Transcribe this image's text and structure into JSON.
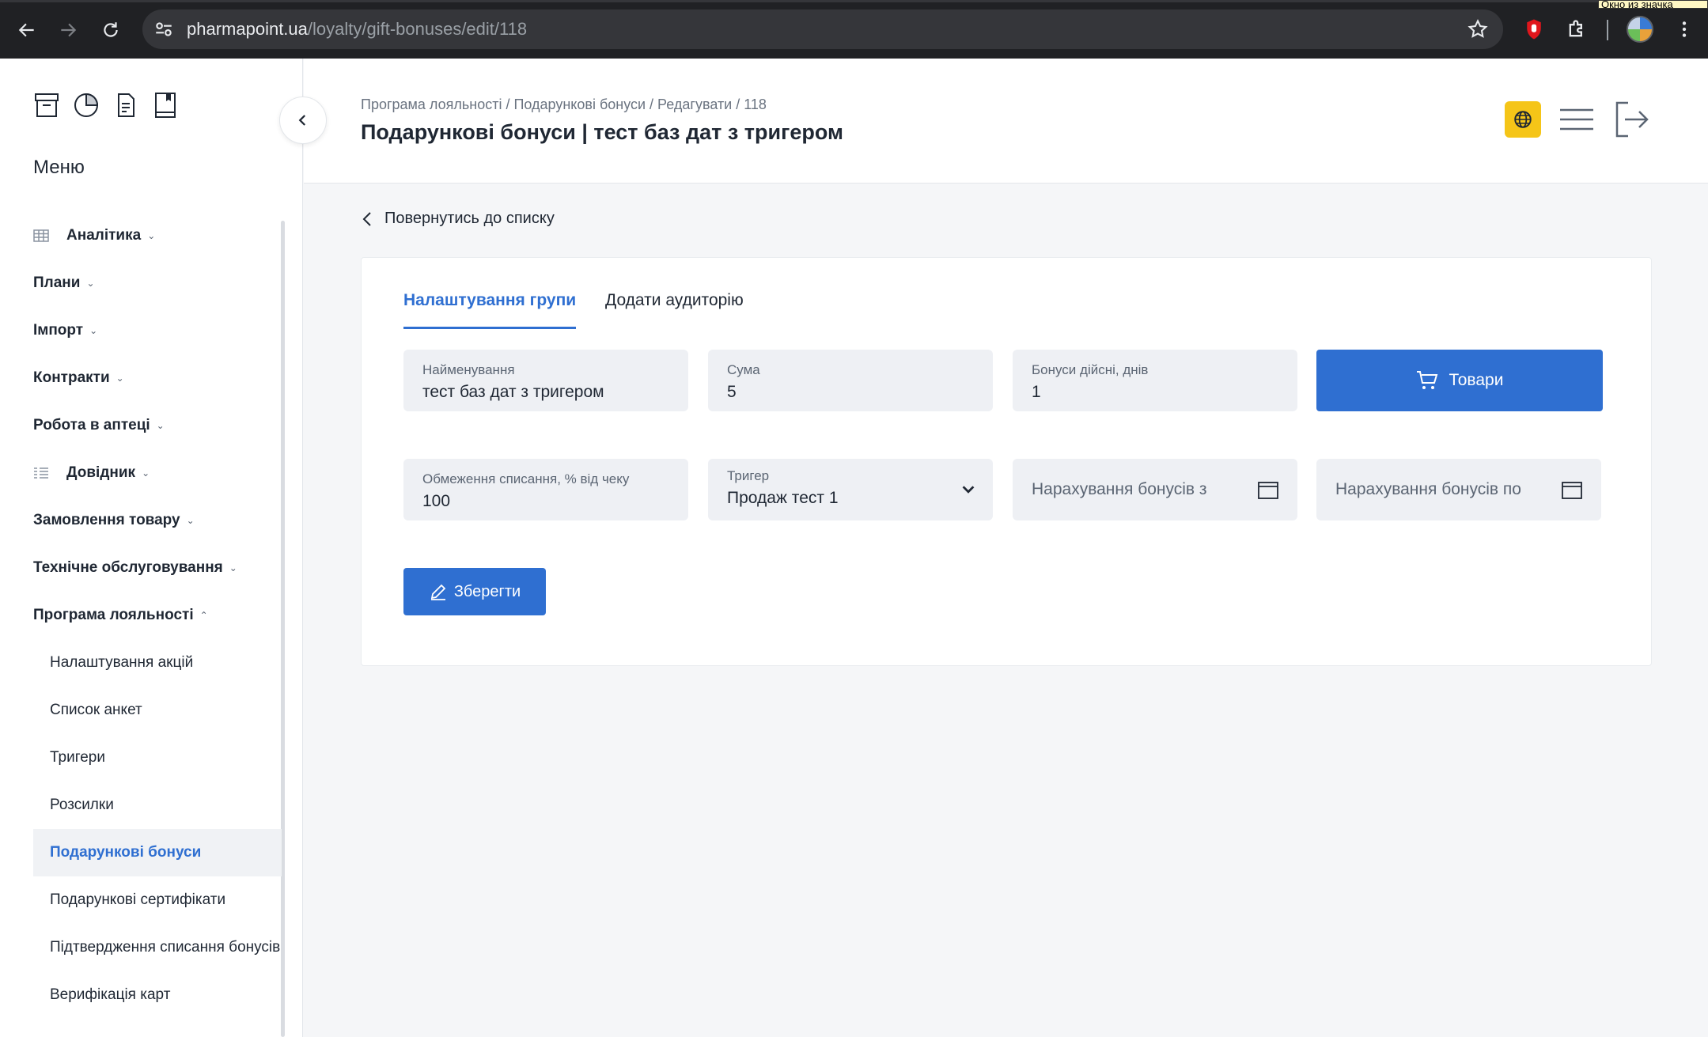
{
  "browser": {
    "url_host": "pharmapoint.ua",
    "url_path": "/loyalty/gift-bonuses/edit/118",
    "tooltip": "Окно из значка"
  },
  "sidebar": {
    "menu_title": "Меню",
    "items": [
      {
        "label": "Аналітика",
        "icon": "table-icon"
      },
      {
        "label": "Плани"
      },
      {
        "label": "Імпорт"
      },
      {
        "label": "Контракти"
      },
      {
        "label": "Робота в аптеці"
      },
      {
        "label": "Довідник",
        "icon": "list-icon"
      },
      {
        "label": "Замовлення товару"
      },
      {
        "label": "Технічне обслуговування"
      },
      {
        "label": "Програма лояльності"
      }
    ],
    "subitems": [
      {
        "label": "Налаштування акцій"
      },
      {
        "label": "Список анкет"
      },
      {
        "label": "Тригери"
      },
      {
        "label": "Розсилки"
      },
      {
        "label": "Подарункові бонуси"
      },
      {
        "label": "Подарункові сертифікати"
      },
      {
        "label": "Підтвердження списання бонусів"
      },
      {
        "label": "Верифікація карт"
      }
    ]
  },
  "header": {
    "breadcrumb": "Програма лояльності / Подарункові бонуси / Редагувати / 118",
    "title": "Подарункові бонуси | тест баз дат з тригером"
  },
  "main": {
    "back_link": "Повернутись до списку",
    "tabs": [
      {
        "label": "Налаштування групи"
      },
      {
        "label": "Додати аудиторію"
      }
    ],
    "fields": {
      "name": {
        "label": "Найменування",
        "value": "тест баз дат з тригером"
      },
      "sum": {
        "label": "Сума",
        "value": "5"
      },
      "valid_days": {
        "label": "Бонуси дійсні, днів",
        "value": "1"
      },
      "limit": {
        "label": "Обмеження списання, % від чеку",
        "value": "100"
      },
      "trigger": {
        "label": "Тригер",
        "value": "Продаж тест 1"
      },
      "date_from": {
        "placeholder": "Нарахування бонусів з"
      },
      "date_to": {
        "placeholder": "Нарахування бонусів по"
      }
    },
    "goods_button": "Товари",
    "save_button": "Зберегти"
  },
  "colors": {
    "accent": "#2f6fd1",
    "globe_button": "#f5c518"
  }
}
